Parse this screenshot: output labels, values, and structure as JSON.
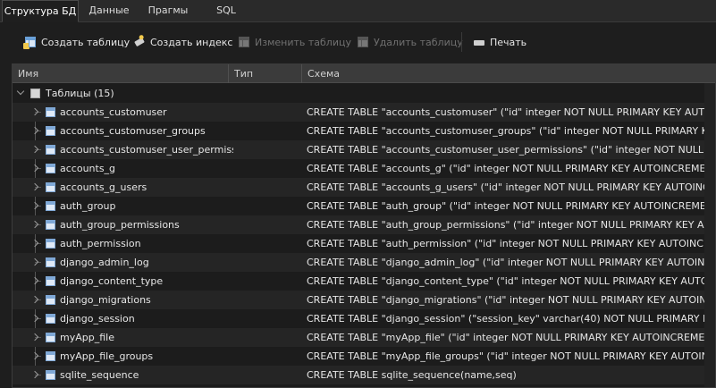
{
  "tabs": [
    {
      "label": "Структура БД",
      "active": true
    },
    {
      "label": "Данные",
      "active": false
    },
    {
      "label": "Прагмы",
      "active": false
    },
    {
      "label": "SQL",
      "active": false
    }
  ],
  "toolbar": {
    "create_table": "Создать таблицу",
    "create_index": "Создать индекс",
    "modify_table": "Изменить таблицу",
    "delete_table": "Удалить таблицу",
    "print": "Печать"
  },
  "tree": {
    "columns": {
      "name": "Имя",
      "type": "Тип",
      "schema": "Схема"
    },
    "group_label": "Таблицы (15)",
    "rows": [
      {
        "name": "accounts_customuser",
        "schema": "CREATE TABLE \"accounts_customuser\" (\"id\" integer NOT NULL PRIMARY KEY AUTOINCREMENT,"
      },
      {
        "name": "accounts_customuser_groups",
        "schema": "CREATE TABLE \"accounts_customuser_groups\" (\"id\" integer NOT NULL PRIMARY KEY AUTOINCREMENT,"
      },
      {
        "name": "accounts_customuser_user_permiss...",
        "schema": "CREATE TABLE \"accounts_customuser_user_permissions\" (\"id\" integer NOT NULL PRIMARY KEY"
      },
      {
        "name": "accounts_g",
        "schema": "CREATE TABLE \"accounts_g\" (\"id\" integer NOT NULL PRIMARY KEY AUTOINCREMENT, \"owner"
      },
      {
        "name": "accounts_g_users",
        "schema": "CREATE TABLE \"accounts_g_users\" (\"id\" integer NOT NULL PRIMARY KEY AUTOINCREMENT,"
      },
      {
        "name": "auth_group",
        "schema": "CREATE TABLE \"auth_group\" (\"id\" integer NOT NULL PRIMARY KEY AUTOINCREMENT, \"name"
      },
      {
        "name": "auth_group_permissions",
        "schema": "CREATE TABLE \"auth_group_permissions\" (\"id\" integer NOT NULL PRIMARY KEY AUTOINCREMENT,"
      },
      {
        "name": "auth_permission",
        "schema": "CREATE TABLE \"auth_permission\" (\"id\" integer NOT NULL PRIMARY KEY AUTOINCREMENT,"
      },
      {
        "name": "django_admin_log",
        "schema": "CREATE TABLE \"django_admin_log\" (\"id\" integer NOT NULL PRIMARY KEY AUTOINCREMENT"
      },
      {
        "name": "django_content_type",
        "schema": "CREATE TABLE \"django_content_type\" (\"id\" integer NOT NULL PRIMARY KEY AUTOINCREMENT"
      },
      {
        "name": "django_migrations",
        "schema": "CREATE TABLE \"django_migrations\" (\"id\" integer NOT NULL PRIMARY KEY AUTOINCREMENT"
      },
      {
        "name": "django_session",
        "schema": "CREATE TABLE \"django_session\" (\"session_key\" varchar(40) NOT NULL PRIMARY KEY, \"session"
      },
      {
        "name": "myApp_file",
        "schema": "CREATE TABLE \"myApp_file\" (\"id\" integer NOT NULL PRIMARY KEY AUTOINCREMENT, \"file\" v"
      },
      {
        "name": "myApp_file_groups",
        "schema": "CREATE TABLE \"myApp_file_groups\" (\"id\" integer NOT NULL PRIMARY KEY AUTOINCREMENT"
      },
      {
        "name": "sqlite_sequence",
        "schema": "CREATE TABLE sqlite_sequence(name,seq)"
      }
    ]
  },
  "icons": {
    "create_table": "table-add-icon",
    "create_index": "index-icon",
    "modify_table": "table-edit-icon",
    "delete_table": "table-delete-icon",
    "print": "printer-icon",
    "row": "table-icon",
    "group": "folder-icon"
  }
}
